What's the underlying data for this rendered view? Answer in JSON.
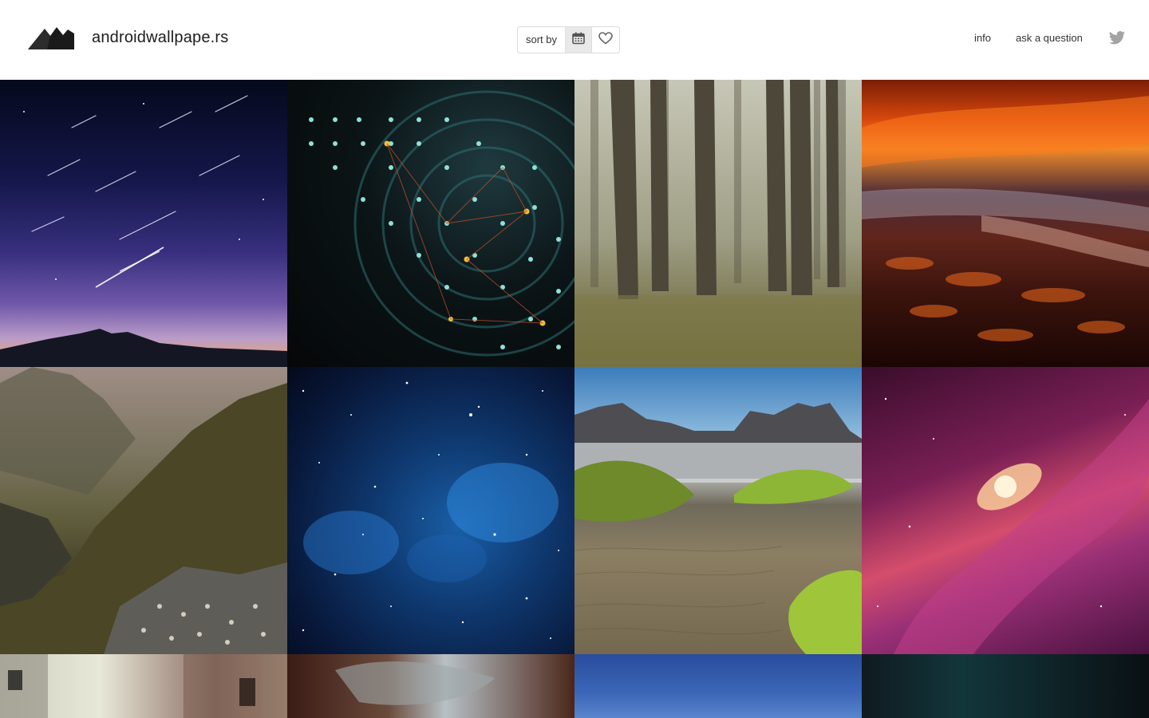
{
  "header": {
    "site_name": "androidwallpape.rs",
    "sort": {
      "label": "sort by",
      "options": [
        "date",
        "favorites"
      ],
      "active": "date"
    },
    "nav": [
      {
        "label": "info"
      },
      {
        "label": "ask a question"
      }
    ],
    "social_icon": "twitter-icon"
  },
  "colors": {
    "header_background": "#ffffff",
    "active_sort_background": "#e9e9e9",
    "icon_gray": "#9a9a9a",
    "text": "#222222"
  },
  "wallpapers": [
    {
      "subject": "star trails over mountain"
    },
    {
      "subject": "abstract dotted circles"
    },
    {
      "subject": "misty pine forest"
    },
    {
      "subject": "orange sunset over rocky shore"
    },
    {
      "subject": "mountain valley with flowers"
    },
    {
      "subject": "blue starfield nebula"
    },
    {
      "subject": "sand dunes with grass and mountains"
    },
    {
      "subject": "pink spiral galaxy"
    },
    {
      "subject": "old town street"
    },
    {
      "subject": "nebula"
    },
    {
      "subject": "blue sky"
    },
    {
      "subject": "dark teal night sky"
    }
  ]
}
